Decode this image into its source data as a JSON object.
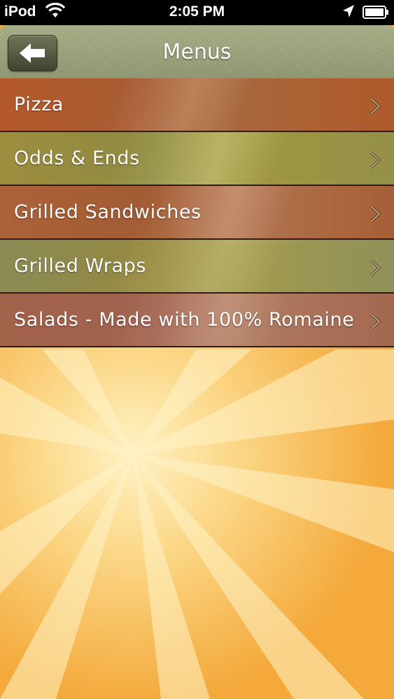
{
  "status_bar": {
    "carrier": "iPod",
    "time": "2:05 PM",
    "wifi_icon": "wifi-icon",
    "location_icon": "location-arrow-icon",
    "battery_icon": "battery-icon"
  },
  "nav_bar": {
    "title": "Menus",
    "back_icon": "back-arrow-icon"
  },
  "menu_items": [
    {
      "label": "Pizza"
    },
    {
      "label": "Odds & Ends"
    },
    {
      "label": "Grilled Sandwiches"
    },
    {
      "label": "Grilled Wraps"
    },
    {
      "label": "Salads - Made with 100% Romaine"
    }
  ],
  "colors": {
    "nav_bar": "#9aa27c",
    "row_orange": "#b05a2a",
    "row_olive": "#97883f",
    "background": "#f4a93a"
  }
}
